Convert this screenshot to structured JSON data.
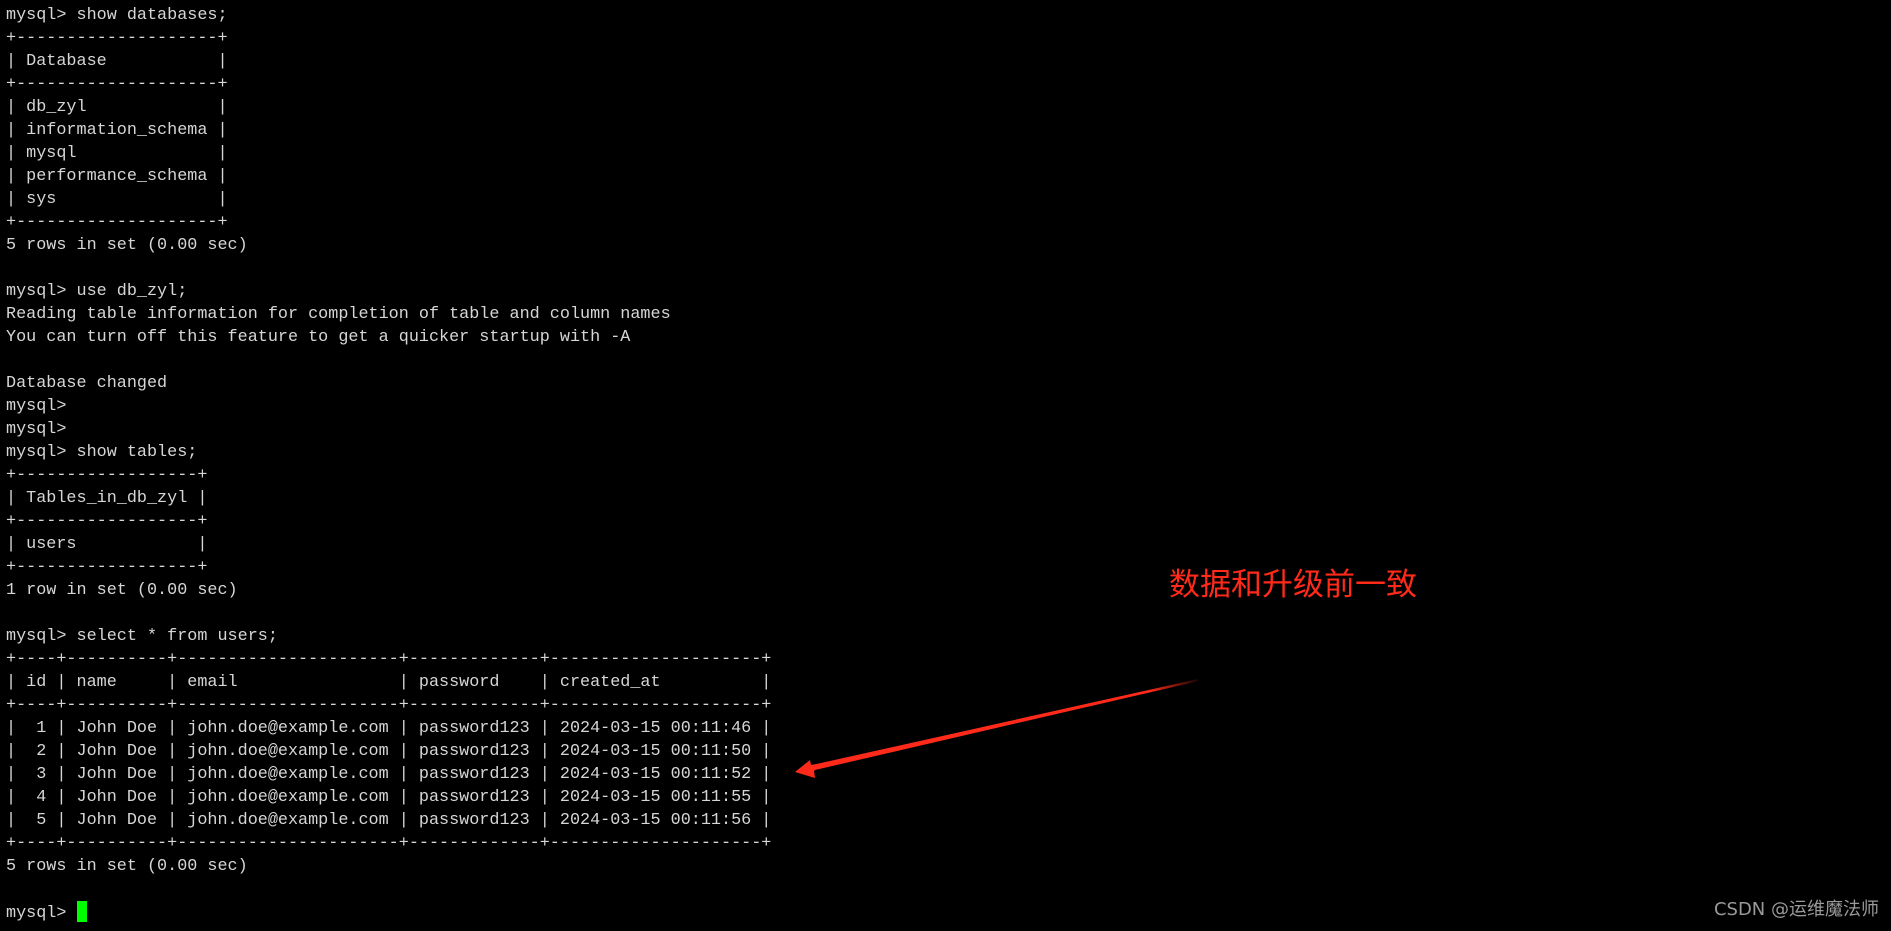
{
  "terminal": {
    "prompt": "mysql> ",
    "lines": [
      {
        "text": "mysql>",
        "kind": "prompt"
      },
      {
        "text": "mysql> show databases;",
        "kind": "command"
      },
      {
        "text": "+--------------------+",
        "kind": "table-border"
      },
      {
        "text": "| Database           |",
        "kind": "table-header"
      },
      {
        "text": "+--------------------+",
        "kind": "table-border"
      },
      {
        "text": "| db_zyl             |",
        "kind": "table-row"
      },
      {
        "text": "| information_schema |",
        "kind": "table-row"
      },
      {
        "text": "| mysql              |",
        "kind": "table-row"
      },
      {
        "text": "| performance_schema |",
        "kind": "table-row"
      },
      {
        "text": "| sys                |",
        "kind": "table-row"
      },
      {
        "text": "+--------------------+",
        "kind": "table-border"
      },
      {
        "text": "5 rows in set (0.00 sec)",
        "kind": "status"
      },
      {
        "text": "",
        "kind": "blank"
      },
      {
        "text": "mysql> use db_zyl;",
        "kind": "command"
      },
      {
        "text": "Reading table information for completion of table and column names",
        "kind": "output"
      },
      {
        "text": "You can turn off this feature to get a quicker startup with -A",
        "kind": "output"
      },
      {
        "text": "",
        "kind": "blank"
      },
      {
        "text": "Database changed",
        "kind": "output"
      },
      {
        "text": "mysql>",
        "kind": "prompt"
      },
      {
        "text": "mysql>",
        "kind": "prompt"
      },
      {
        "text": "mysql> show tables;",
        "kind": "command"
      },
      {
        "text": "+------------------+",
        "kind": "table-border"
      },
      {
        "text": "| Tables_in_db_zyl |",
        "kind": "table-header"
      },
      {
        "text": "+------------------+",
        "kind": "table-border"
      },
      {
        "text": "| users            |",
        "kind": "table-row"
      },
      {
        "text": "+------------------+",
        "kind": "table-border"
      },
      {
        "text": "1 row in set (0.00 sec)",
        "kind": "status"
      },
      {
        "text": "",
        "kind": "blank"
      },
      {
        "text": "mysql> select * from users;",
        "kind": "command"
      },
      {
        "text": "+----+----------+----------------------+-------------+---------------------+",
        "kind": "table-border"
      },
      {
        "text": "| id | name     | email                | password    | created_at          |",
        "kind": "table-header"
      },
      {
        "text": "+----+----------+----------------------+-------------+---------------------+",
        "kind": "table-border"
      },
      {
        "text": "|  1 | John Doe | john.doe@example.com | password123 | 2024-03-15 00:11:46 |",
        "kind": "table-row"
      },
      {
        "text": "|  2 | John Doe | john.doe@example.com | password123 | 2024-03-15 00:11:50 |",
        "kind": "table-row"
      },
      {
        "text": "|  3 | John Doe | john.doe@example.com | password123 | 2024-03-15 00:11:52 |",
        "kind": "table-row"
      },
      {
        "text": "|  4 | John Doe | john.doe@example.com | password123 | 2024-03-15 00:11:55 |",
        "kind": "table-row"
      },
      {
        "text": "|  5 | John Doe | john.doe@example.com | password123 | 2024-03-15 00:11:56 |",
        "kind": "table-row"
      },
      {
        "text": "+----+----------+----------------------+-------------+---------------------+",
        "kind": "table-border"
      },
      {
        "text": "5 rows in set (0.00 sec)",
        "kind": "status"
      },
      {
        "text": "",
        "kind": "blank"
      }
    ],
    "current_input": "",
    "cursor_color": "#00ff00",
    "text_color": "#d6d6d6",
    "background_color": "#000000"
  },
  "annotation": {
    "text": "数据和升级前一致",
    "color": "#ff2a1a"
  },
  "watermark": {
    "text": "CSDN @运维魔法师"
  }
}
